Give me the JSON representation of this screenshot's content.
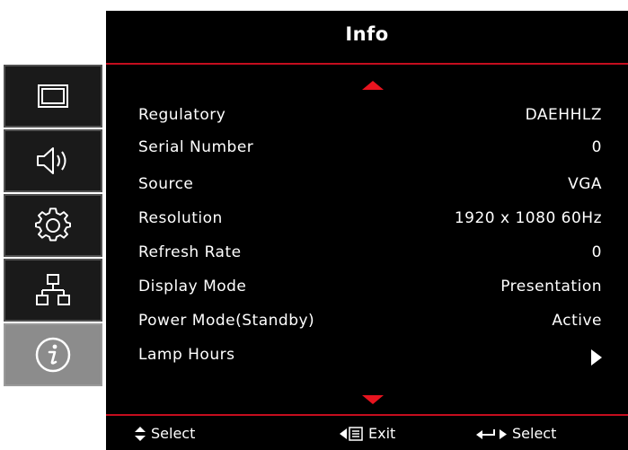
{
  "header": {
    "title": "Info"
  },
  "sidebar": {
    "tabs": [
      {
        "icon": "display-icon",
        "active": false
      },
      {
        "icon": "speaker-icon",
        "active": false
      },
      {
        "icon": "gear-icon",
        "active": false
      },
      {
        "icon": "network-icon",
        "active": false
      },
      {
        "icon": "info-icon",
        "active": true
      }
    ]
  },
  "info": {
    "rows": [
      {
        "label": "Regulatory",
        "value": "DAEHHLZ"
      },
      {
        "label": "Serial Number",
        "value": "0"
      },
      {
        "label": "Source",
        "value": "VGA"
      },
      {
        "label": "Resolution",
        "value": "1920 x 1080 60Hz"
      },
      {
        "label": "Refresh Rate",
        "value": "0"
      },
      {
        "label": "Display Mode",
        "value": "Presentation"
      },
      {
        "label": "Power Mode(Standby)",
        "value": "Active"
      },
      {
        "label": "Lamp Hours",
        "value": ""
      }
    ]
  },
  "footer": {
    "select_label": "Select",
    "exit_label": "Exit",
    "enter_select_label": "Select"
  },
  "colors": {
    "accent_red": "#e8141f",
    "divider_red": "#c40d1e",
    "osd_background": "#000000",
    "active_tab": "#8c8c8c"
  }
}
